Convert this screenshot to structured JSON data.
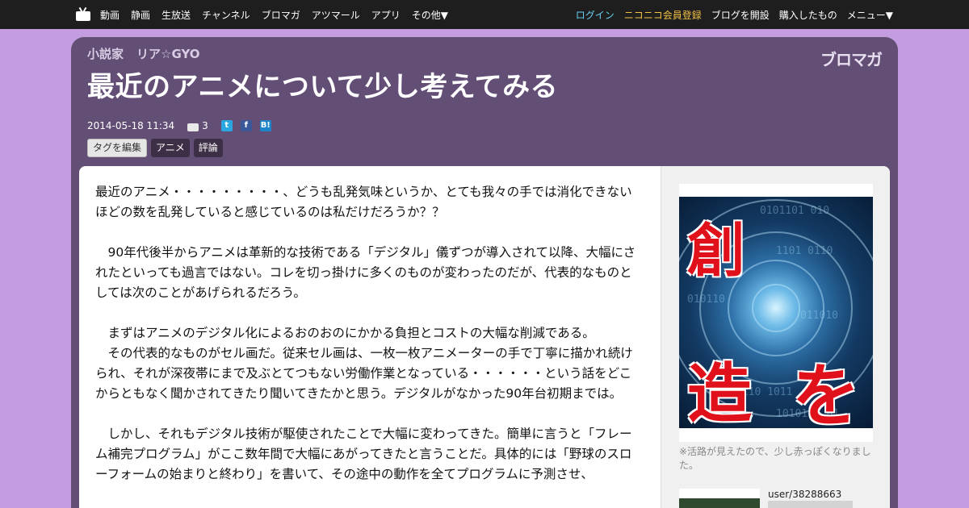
{
  "nav": {
    "left": [
      "動画",
      "静画",
      "生放送",
      "チャンネル",
      "ブロマガ",
      "アツマール",
      "アプリ",
      "その他▼"
    ],
    "login": "ログイン",
    "register": "ニコニコ会員登録",
    "open_blog": "ブログを開設",
    "purchased": "購入したもの",
    "menu": "メニュー▼"
  },
  "header": {
    "author_prefix": "小説家",
    "author_name": "リア☆GYO",
    "logo": "ブロマガ",
    "title": "最近のアニメについて少し考えてみる",
    "date": "2014-05-18 11:34",
    "comment_count": "3",
    "tags": {
      "edit_label": "タグを編集",
      "items": [
        "アニメ",
        "評論"
      ]
    }
  },
  "article": {
    "p1": "最近のアニメ・・・・・・・・・、どうも乱発気味というか、とても我々の手では消化できないほどの数を乱発していると感じているのは私だけだろうか？？",
    "p2": "　90年代後半からアニメは革新的な技術である「デジタル」儀ずつが導入されて以降、大幅にされたといっても過言ではない。コレを切っ掛けに多くのものが変わったのだが、代表的なものとしては次のことがあげられるだろう。",
    "p3": "　まずはアニメのデジタル化によるおのおのにかかる負担とコストの大幅な削減である。",
    "p4": "　その代表的なものがセル画だ。従来セル画は、一枚一枚アニメーターの手で丁寧に描かれ続けられ、それが深夜帯にまで及ぶとてつもない労働作業となっている・・・・・・という話をどこからともなく聞かされてきたり聞いてきたかと思う。デジタルがなかった90年台初期までは。",
    "p5": "　しかし、それもデジタル技術が駆使されたことで大幅に変わってきた。簡単に言うと「フレーム補完プログラム」がここ数年間で大幅にあがってきたと言うことだ。具体的には「野球のスローフォームの始まりと終わり」を書いて、その途中の動作を全てプログラムに予測させ、"
  },
  "sidebar": {
    "thumb_text": [
      "創",
      "造",
      "を"
    ],
    "caption": "※活路が見えたので、少し赤っぽくなりました。",
    "user": "user/38288663"
  }
}
